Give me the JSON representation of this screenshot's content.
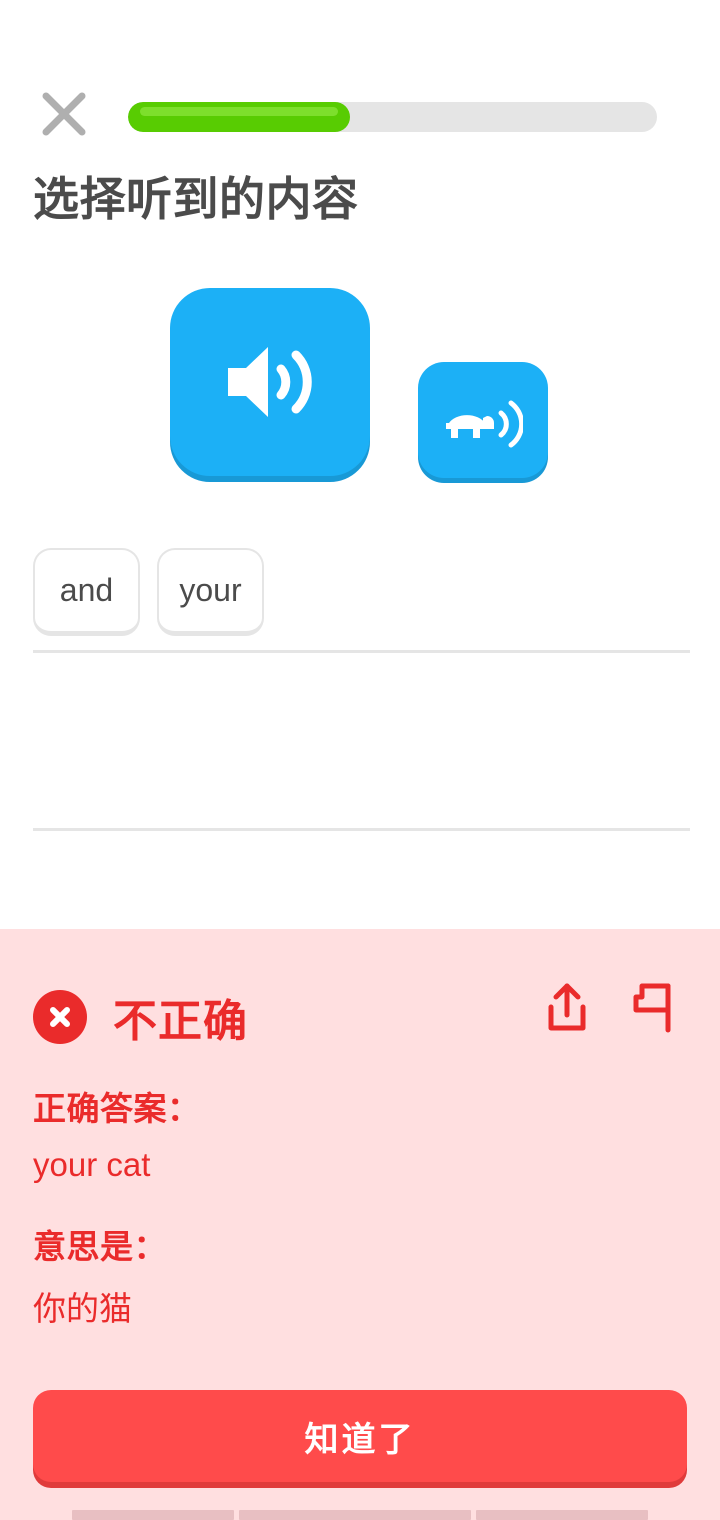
{
  "header": {
    "close_icon": "close-x-icon",
    "progress": {
      "percent": 42,
      "fill_color": "#58cc02",
      "track_color": "#e5e5e5"
    }
  },
  "exercise": {
    "title": "选择听到的内容",
    "audio": {
      "play_icon": "speaker-icon",
      "slow_play_icon": "turtle-slow-audio-icon",
      "button_color": "#1cb0f6"
    },
    "word_bank": [
      {
        "label": "and"
      },
      {
        "label": "your"
      }
    ],
    "answer_slots": 2
  },
  "feedback": {
    "status": "不正确",
    "status_icon": "circle-x-icon",
    "accent_color": "#ea2b2b",
    "background_color": "#ffdfe0",
    "share_icon": "share-upload-icon",
    "report_icon": "flag-report-icon",
    "correct_answer_label": "正确答案：",
    "correct_answer_value": "your cat",
    "meaning_label": "意思是：",
    "meaning_value": "你的猫",
    "continue_label": "知道了",
    "continue_color": "#ff4b4b"
  }
}
